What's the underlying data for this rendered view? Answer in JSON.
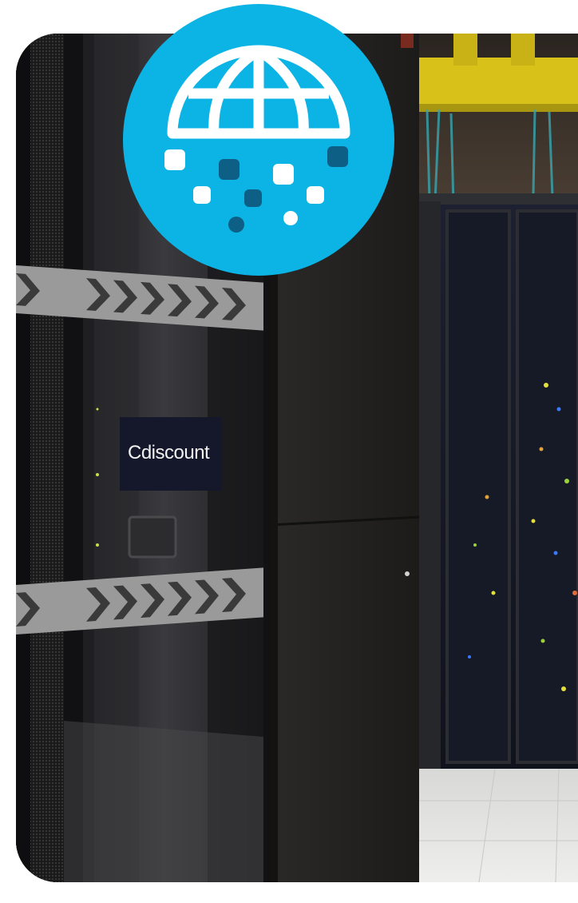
{
  "photo": {
    "subject": "server-room-racks",
    "sign_text": "Cdiscount"
  },
  "badge": {
    "icon": "globe-data-icon",
    "background_color": "#0bb4e4",
    "icon_color": "#ffffff",
    "dot_dark_color": "#0e5f86"
  }
}
